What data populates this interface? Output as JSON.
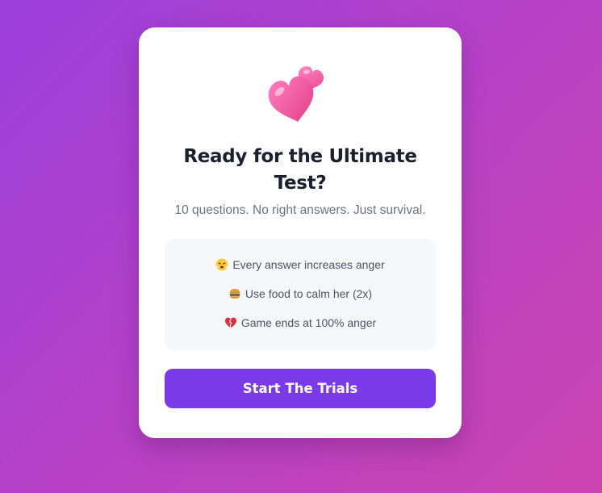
{
  "intro": {
    "hero_icon": "two-hearts-icon",
    "title": "Ready for the Ultimate Test?",
    "subtitle": "10 questions. No right answers. Just survival.",
    "rules": [
      {
        "icon": "steaming-face-icon",
        "text": "Every answer increases anger"
      },
      {
        "icon": "burger-icon",
        "text": "Use food to calm her (2x)"
      },
      {
        "icon": "broken-heart-icon",
        "text": "Game ends at 100% anger"
      }
    ],
    "start_label": "Start The Trials"
  },
  "colors": {
    "accent": "#7b3aea",
    "heart_pink": "#f0509a",
    "background_start": "#9b3fdc",
    "background_end": "#cc44b0"
  }
}
